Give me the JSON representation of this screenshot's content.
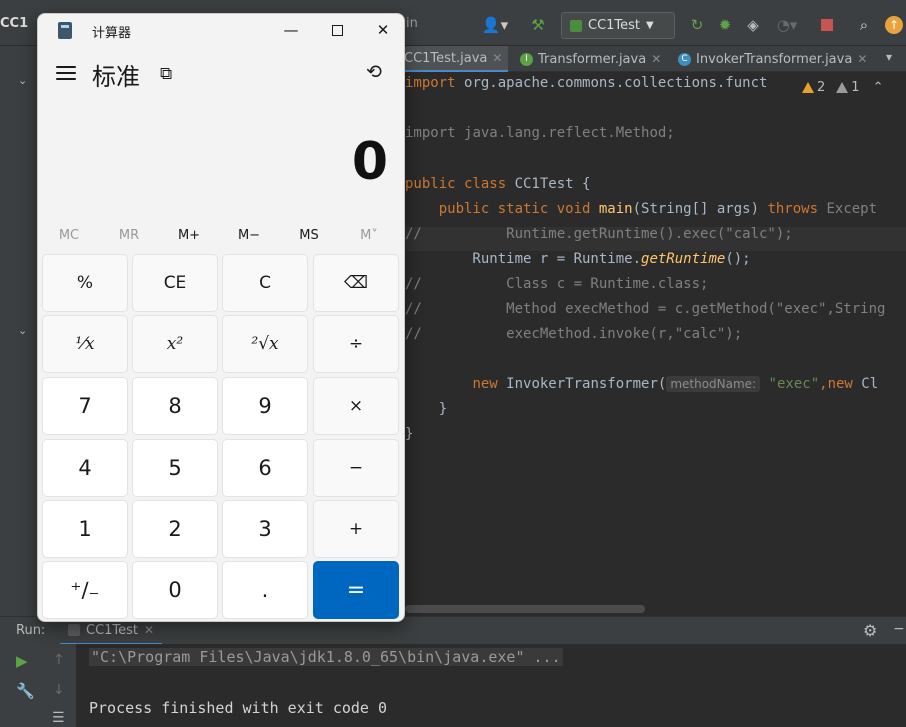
{
  "ide": {
    "project_name": "CC1",
    "nav_fragment": "in",
    "run_config": "CC1Test",
    "tabs": [
      {
        "label": "CC1Test.java"
      },
      {
        "label": "Transformer.java"
      },
      {
        "label": "InvokerTransformer.java"
      }
    ],
    "inspections": {
      "warnings": "2",
      "weak": "1"
    },
    "code_lines": [
      {
        "a": "import ",
        "b": "org.apache.commons.collections.funct"
      },
      {
        "a": "import ",
        "b": "java.lang.reflect.Method;"
      },
      {
        "a": "public class ",
        "b": "CC1Test {"
      },
      {
        "a": "    public static void ",
        "fn": "main",
        "b": "(String[] args) ",
        "c": "throws ",
        "d": "Except"
      },
      {
        "a": "//          Runtime.getRuntime().exec(\"calc\");"
      },
      {
        "a": "        Runtime r = Runtime.",
        "it": "getRuntime",
        "b": "();"
      },
      {
        "a": "//          Class c = Runtime.class;"
      },
      {
        "a": "//          Method execMethod = c.getMethod(\"exec\",String"
      },
      {
        "a": "//          execMethod.invoke(r,\"calc\");"
      },
      {
        "a": "        ",
        "kw": "new ",
        "b": "InvokerTransformer(",
        "hint": "methodName:",
        "st": "\"exec\"",
        "c": ",",
        "kw2": "new ",
        "d": "Cl"
      },
      {
        "a": "    }"
      },
      {
        "a": "}"
      }
    ],
    "run_label": "Run:",
    "run_tab": "CC1Test",
    "console": {
      "cmd": "\"C:\\Program Files\\Java\\jdk1.8.0_65\\bin\\java.exe\" ...",
      "exit": "Process finished with exit code 0"
    }
  },
  "calc": {
    "title": "计算器",
    "mode": "标准",
    "display": "0",
    "memory": [
      {
        "label": "MC",
        "enabled": false
      },
      {
        "label": "MR",
        "enabled": false
      },
      {
        "label": "M+",
        "enabled": true
      },
      {
        "label": "M−",
        "enabled": true
      },
      {
        "label": "MS",
        "enabled": true
      },
      {
        "label": "M˅",
        "enabled": false
      }
    ],
    "keys": [
      [
        "%",
        "CE",
        "C",
        "⌫"
      ],
      [
        "⅟x",
        "x²",
        "²√x",
        "÷"
      ],
      [
        "7",
        "8",
        "9",
        "×"
      ],
      [
        "4",
        "5",
        "6",
        "−"
      ],
      [
        "1",
        "2",
        "3",
        "+"
      ],
      [
        "⁺∕₋",
        "0",
        ".",
        "="
      ]
    ],
    "accent": "#0067c0"
  },
  "colors": {
    "ide_bg": "#2b2b2b",
    "keyword": "#cc7832",
    "comment": "#808080",
    "string": "#6a8759"
  }
}
